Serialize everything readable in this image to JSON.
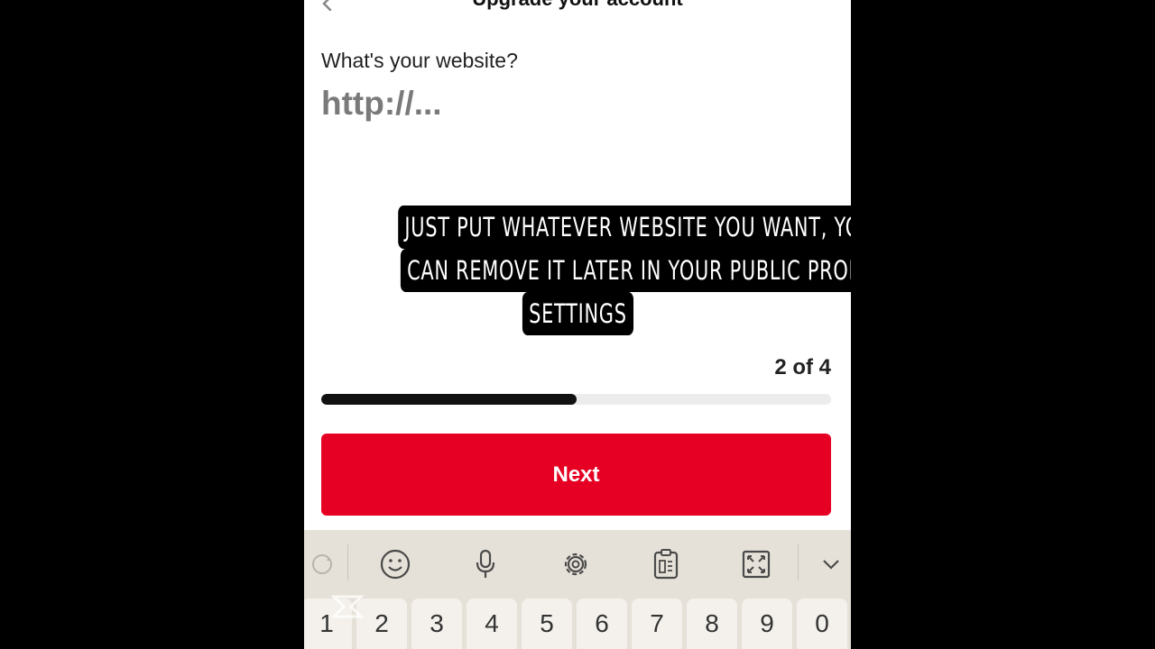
{
  "header": {
    "title": "Upgrade your account"
  },
  "form": {
    "question": "What's your website?",
    "url_placeholder": "http://...",
    "url_value": ""
  },
  "caption": {
    "lines": [
      "JUST PUT WHATEVER WEBSITE YOU WANT, YOU",
      "CAN REMOVE IT LATER IN YOUR PUBLIC PROFILE",
      "SETTINGS"
    ]
  },
  "progress": {
    "step_label": "2 of 4",
    "current": 2,
    "total": 4,
    "fraction": 0.5
  },
  "actions": {
    "next_label": "Next"
  },
  "colors": {
    "accent": "#e60023",
    "progress_fill": "#111111",
    "progress_track": "#ececec",
    "keyboard_bg": "#e6e1d8",
    "background": "#000000"
  },
  "keyboard": {
    "toolbar_icons": [
      "sync-icon",
      "emoji-icon",
      "microphone-icon",
      "gear-icon",
      "clipboard-icon",
      "resize-icon",
      "chevron-down-icon"
    ],
    "number_keys": [
      "1",
      "2",
      "3",
      "4",
      "5",
      "6",
      "7",
      "8",
      "9",
      "0"
    ]
  }
}
